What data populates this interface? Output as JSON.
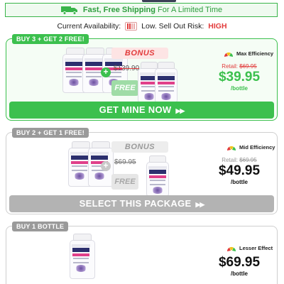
{
  "shipping": {
    "bold": "Fast, Free Shipping",
    "rest": " For A Limited Time"
  },
  "availability": {
    "label": "Current Availability:",
    "risk_label": "Low. Sell Out Risk:",
    "risk_value": "HIGH"
  },
  "colors": {
    "accent_green": "#3cc04e",
    "alert_red": "#e23b3b",
    "muted_grey": "#b3b3b3"
  },
  "packages": [
    {
      "tag": "BUY 3 + GET 2 FREE!",
      "bonus_label": "BONUS",
      "bonus_strike": "$139.90",
      "bonus_free": "FREE",
      "effect": "Max Efficiency",
      "retail_label": "Retail:",
      "retail_price": "$69.95",
      "price": "$39.95",
      "per": "/bottle",
      "cta": "GET MINE NOW"
    },
    {
      "tag": "BUY 2 + GET 1 FREE!",
      "bonus_label": "BONUS",
      "bonus_strike": "$69.95",
      "bonus_free": "FREE",
      "effect": "Mid Efficiency",
      "retail_label": "Retail:",
      "retail_price": "$69.95",
      "price": "$49.95",
      "per": "/bottle",
      "cta": "SELECT THIS PACKAGE"
    },
    {
      "tag": "BUY 1 BOTTLE",
      "effect": "Lesser Effect",
      "price": "$69.95",
      "per": "/bottle"
    }
  ]
}
